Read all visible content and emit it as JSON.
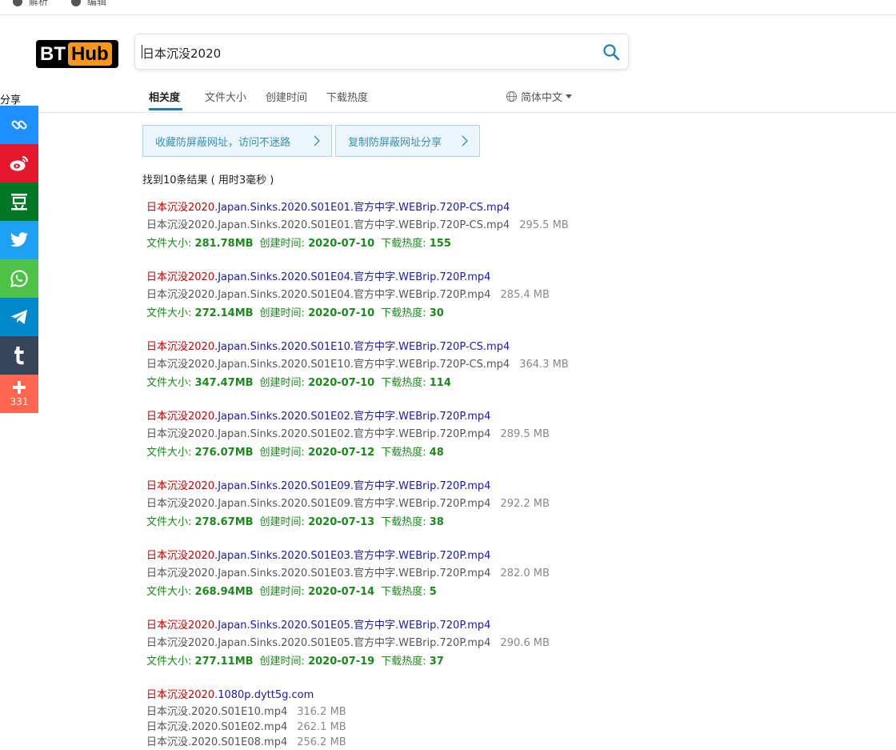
{
  "topbar": {
    "item1": "解析",
    "item2": "编辑"
  },
  "logo": {
    "part1": "BT",
    "part2": "Hub"
  },
  "search": {
    "query": "日本沉没2020"
  },
  "share": {
    "label": "分享",
    "count": "331",
    "buttons": [
      {
        "name": "copy-link",
        "color": "#1e90ff"
      },
      {
        "name": "weibo",
        "color": "#e6162d"
      },
      {
        "name": "douban",
        "color": "#007722"
      },
      {
        "name": "twitter",
        "color": "#1da1f2"
      },
      {
        "name": "whatsapp",
        "color": "#4dc247"
      },
      {
        "name": "telegram",
        "color": "#0088cc"
      },
      {
        "name": "tumblr",
        "color": "#35465c"
      },
      {
        "name": "more",
        "color": "#ff6550"
      }
    ]
  },
  "sort": {
    "relevance": "相关度",
    "size": "文件大小",
    "created": "创建时间",
    "popularity": "下载热度",
    "language": "简体中文"
  },
  "banners": {
    "bookmark": "收藏防屏蔽网址，访问不迷路",
    "copy": "复制防屏蔽网址分享"
  },
  "results_count": "找到10条结果 ( 用时3毫秒 )",
  "labels": {
    "size": "文件大小:",
    "created": "创建时间:",
    "heat": "下载热度:"
  },
  "results": [
    {
      "title_hl": "日本沉没2020",
      "title_rest": ".Japan.Sinks.2020.S01E01.官方中字.WEBrip.720P-CS.mp4",
      "file": "日本沉没2020.Japan.Sinks.2020.S01E01.官方中字.WEBrip.720P-CS.mp4",
      "file_size": "295.5 MB",
      "size": "281.78MB",
      "date": "2020-07-10",
      "heat": "155"
    },
    {
      "title_hl": "日本沉没2020",
      "title_rest": ".Japan.Sinks.2020.S01E04.官方中字.WEBrip.720P.mp4",
      "file": "日本沉没2020.Japan.Sinks.2020.S01E04.官方中字.WEBrip.720P.mp4",
      "file_size": "285.4 MB",
      "size": "272.14MB",
      "date": "2020-07-10",
      "heat": "30"
    },
    {
      "title_hl": "日本沉没2020",
      "title_rest": ".Japan.Sinks.2020.S01E10.官方中字.WEBrip.720P-CS.mp4",
      "file": "日本沉没2020.Japan.Sinks.2020.S01E10.官方中字.WEBrip.720P-CS.mp4",
      "file_size": "364.3 MB",
      "size": "347.47MB",
      "date": "2020-07-10",
      "heat": "114"
    },
    {
      "title_hl": "日本沉没2020",
      "title_rest": ".Japan.Sinks.2020.S01E02.官方中字.WEBrip.720P.mp4",
      "file": "日本沉没2020.Japan.Sinks.2020.S01E02.官方中字.WEBrip.720P.mp4",
      "file_size": "289.5 MB",
      "size": "276.07MB",
      "date": "2020-07-12",
      "heat": "48"
    },
    {
      "title_hl": "日本沉没2020",
      "title_rest": ".Japan.Sinks.2020.S01E09.官方中字.WEBrip.720P.mp4",
      "file": "日本沉没2020.Japan.Sinks.2020.S01E09.官方中字.WEBrip.720P.mp4",
      "file_size": "292.2 MB",
      "size": "278.67MB",
      "date": "2020-07-13",
      "heat": "38"
    },
    {
      "title_hl": "日本沉没2020",
      "title_rest": ".Japan.Sinks.2020.S01E03.官方中字.WEBrip.720P.mp4",
      "file": "日本沉没2020.Japan.Sinks.2020.S01E03.官方中字.WEBrip.720P.mp4",
      "file_size": "282.0 MB",
      "size": "268.94MB",
      "date": "2020-07-14",
      "heat": "5"
    },
    {
      "title_hl": "日本沉没2020",
      "title_rest": ".Japan.Sinks.2020.S01E05.官方中字.WEBrip.720P.mp4",
      "file": "日本沉没2020.Japan.Sinks.2020.S01E05.官方中字.WEBrip.720P.mp4",
      "file_size": "290.6 MB",
      "size": "277.11MB",
      "date": "2020-07-19",
      "heat": "37"
    }
  ],
  "last_result": {
    "title_hl": "日本沉没2020",
    "title_rest": ".1080p.dytt5g.com",
    "files": [
      {
        "name": "日本沉没.2020.S01E10.mp4",
        "size": "316.2 MB"
      },
      {
        "name": "日本沉没.2020.S01E02.mp4",
        "size": "262.1 MB"
      },
      {
        "name": "日本沉没.2020.S01E08.mp4",
        "size": "256.2 MB"
      }
    ]
  }
}
